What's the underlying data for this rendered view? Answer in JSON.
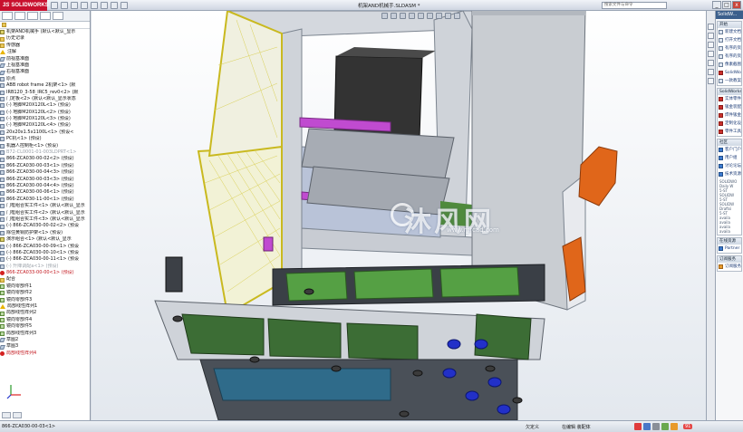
{
  "app": {
    "logo_prefix": "3S",
    "logo_text": "SOLIDWORKS",
    "document_title": "机架AND机械手.SLDASM *",
    "search_placeholder": "搜索文件与命令",
    "window_controls": [
      "_",
      "□",
      "x"
    ]
  },
  "tree": {
    "items": [
      {
        "label": "机架AND机械手  (默认<默认_显示",
        "icon": "asm-icon",
        "kind": "asm"
      },
      {
        "label": "历史记录",
        "icon": "history-icon",
        "kind": "folder"
      },
      {
        "label": "传感器",
        "icon": "sensor-icon",
        "kind": "folder"
      },
      {
        "label": "注解",
        "icon": "warning-icon",
        "kind": "warn"
      },
      {
        "label": "前视基准面",
        "icon": "plane-icon",
        "kind": "plane"
      },
      {
        "label": "上视基准面",
        "icon": "plane-icon",
        "kind": "plane"
      },
      {
        "label": "右视基准面",
        "icon": "plane-icon",
        "kind": "plane"
      },
      {
        "label": "原点",
        "icon": "origin-icon",
        "kind": "part"
      },
      {
        "label": "ABB robot frame 2机架<1> (默",
        "icon": "part-icon",
        "kind": "part"
      },
      {
        "label": "IRB120_3-58_IRC5_rev0<2> (默",
        "icon": "part-icon",
        "kind": "part"
      },
      {
        "label": "门定板<2> (默认<默认_显示状态",
        "icon": "part-icon",
        "kind": "part"
      },
      {
        "label": "(-) 地脚M20X120L<1> (预设)",
        "icon": "part-icon",
        "kind": "part"
      },
      {
        "label": "(-) 地脚M20X120L<2> (预设)",
        "icon": "part-icon",
        "kind": "part"
      },
      {
        "label": "(-) 地脚M20X120L<3> (预设)",
        "icon": "part-icon",
        "kind": "part"
      },
      {
        "label": "(-) 地脚M20X120L<4> (预设)",
        "icon": "part-icon",
        "kind": "part"
      },
      {
        "label": "20x20x1.5x1100L<1> (预设<",
        "icon": "part-icon",
        "kind": "part"
      },
      {
        "label": "PC机<1> (预设)",
        "icon": "part-icon",
        "kind": "part"
      },
      {
        "label": "机器人控制柜<1> (预设)",
        "icon": "part-icon",
        "kind": "part"
      },
      {
        "label": "B72-CL0001-01-003LDPRT<1>",
        "icon": "part-icon",
        "kind": "part",
        "grey": true
      },
      {
        "label": "866-ZCA030-00-02<2> (预设)",
        "icon": "part-icon",
        "kind": "part"
      },
      {
        "label": "866-ZCA030-00-03<1> (预设)",
        "icon": "part-icon",
        "kind": "part"
      },
      {
        "label": "866-ZCA030-00-04<3> (预设)",
        "icon": "part-icon",
        "kind": "part"
      },
      {
        "label": "866-ZCA030-00-03<3> (预设)",
        "icon": "part-icon",
        "kind": "part"
      },
      {
        "label": "866-ZCA030-00-04<4> (预设)",
        "icon": "part-icon",
        "kind": "part"
      },
      {
        "label": "866-ZCA030-00-06<1> (预设)",
        "icon": "part-icon",
        "kind": "part"
      },
      {
        "label": "866-ZCA030-11-00<1> (预设)",
        "icon": "part-icon",
        "kind": "part"
      },
      {
        "label": "门框组合实工件<1> (默认<默认_显示",
        "icon": "part-icon",
        "kind": "part"
      },
      {
        "label": "门框组合实工件<2> (默认<默认_显示",
        "icon": "part-icon",
        "kind": "part"
      },
      {
        "label": "门框组合实工件<3> (默认<默认_显示",
        "icon": "part-icon",
        "kind": "part"
      },
      {
        "label": "(-) 866-ZCA030-00-02<2> (预设",
        "icon": "part-icon",
        "kind": "part"
      },
      {
        "label": "除住黄铜防护架<1> (预设)",
        "icon": "part-icon",
        "kind": "part"
      },
      {
        "label": "演示组合<1> (默认<默认_显示",
        "icon": "asm-icon",
        "kind": "asm"
      },
      {
        "label": "(-) 866-ZCA030-00-09<1> (预设",
        "icon": "part-icon",
        "kind": "part"
      },
      {
        "label": "(-) 866-ZCA030-00-10<1> (预设",
        "icon": "part-icon",
        "kind": "part"
      },
      {
        "label": "(-) 866-ZCA030-00-11<1> (预设",
        "icon": "part-icon",
        "kind": "part"
      },
      {
        "label": "(-) 升降调配a<1> (预设)",
        "icon": "part-icon",
        "kind": "part",
        "grey": true
      },
      {
        "label": "866-ZCA033-00-00<1> (预设)",
        "icon": "error-icon",
        "kind": "err",
        "red": true
      },
      {
        "label": "配合",
        "icon": "mates-icon",
        "kind": "folder"
      },
      {
        "label": "镜向零部件1",
        "icon": "mirror-icon",
        "kind": "pattern"
      },
      {
        "label": "镜向零部件2",
        "icon": "mirror-icon",
        "kind": "pattern"
      },
      {
        "label": "镜向零部件3",
        "icon": "mirror-icon",
        "kind": "pattern"
      },
      {
        "label": "局部线性阵列1",
        "icon": "warning-icon",
        "kind": "warn"
      },
      {
        "label": "局部线性阵列2",
        "icon": "pattern-icon",
        "kind": "pattern"
      },
      {
        "label": "镜向零部件4",
        "icon": "mirror-icon",
        "kind": "pattern"
      },
      {
        "label": "镜向零部件5",
        "icon": "mirror-icon",
        "kind": "pattern"
      },
      {
        "label": "局部线性阵列3",
        "icon": "pattern-icon",
        "kind": "pattern"
      },
      {
        "label": "草图2",
        "icon": "sketch-icon",
        "kind": "plane"
      },
      {
        "label": "草图3",
        "icon": "sketch-icon",
        "kind": "plane"
      },
      {
        "label": "局部线性阵列4",
        "icon": "error-icon",
        "kind": "err",
        "red": true
      }
    ]
  },
  "viewport": {
    "watermark_text": "沐风网",
    "watermark_url": "www.mfcad.com"
  },
  "task_pane": {
    "header": "SolidW...",
    "sections": [
      {
        "title": "开始",
        "items": [
          {
            "label": "新建文档",
            "icon": "new-document-icon",
            "color": ""
          },
          {
            "label": "打开文档",
            "icon": "open-document-icon",
            "color": ""
          },
          {
            "label": "有序的资源",
            "icon": "resource-icon",
            "color": ""
          },
          {
            "label": "有序的资源",
            "icon": "resource-icon",
            "color": ""
          },
          {
            "label": "像素截图",
            "icon": "screenshot-icon",
            "color": ""
          },
          {
            "label": "SolidWo",
            "icon": "solidworks-icon",
            "color": "red"
          },
          {
            "label": "一款教案",
            "icon": "tutorial-icon",
            "color": ""
          }
        ]
      },
      {
        "title": "SolidWorks",
        "items": [
          {
            "label": "实体零件",
            "icon": "solid-part-icon",
            "color": "red"
          },
          {
            "label": "钣金装配",
            "icon": "sheetmetal-icon",
            "color": "red"
          },
          {
            "label": "焊件钣金",
            "icon": "weldment-icon",
            "color": "red"
          },
          {
            "label": "定制化设计",
            "icon": "custom-design-icon",
            "color": "red"
          },
          {
            "label": "零件工具",
            "icon": "part-tools-icon",
            "color": "red"
          }
        ]
      },
      {
        "title": "社区",
        "items": [
          {
            "label": "客户门户",
            "icon": "portal-icon",
            "color": "blue"
          },
          {
            "label": "用户组",
            "icon": "user-group-icon",
            "color": "blue"
          },
          {
            "label": "讨论论坛",
            "icon": "forum-icon",
            "color": "blue"
          },
          {
            "label": "技术资源",
            "icon": "tech-resource-icon",
            "color": "blue"
          }
        ],
        "lines": [
          "SOLIDWO",
          "Daily W",
          "5-ST",
          "SOLIDW",
          "5-ST",
          "SOLIDW",
          "Draftsi",
          "5-ST",
          "availa",
          "availa",
          "availa",
          "availa"
        ]
      },
      {
        "title": "在线资源",
        "items": [
          {
            "label": "Partner S",
            "icon": "partner-icon",
            "color": "blue"
          }
        ]
      },
      {
        "title": "订阅服务",
        "items": [
          {
            "label": "订阅服务",
            "icon": "subscription-icon",
            "color": "orange"
          }
        ]
      }
    ]
  },
  "status": {
    "text": "866-ZCA030-00-03<1>",
    "defined": "欠定义",
    "editing": "在编辑 装配体",
    "badge": "91"
  },
  "colors": {
    "accent": "#c8102e",
    "frame_grey": "#cfd3d9",
    "mesh_yellow": "#e6d24a",
    "pcb_green": "#4f8a3c",
    "robot_orange": "#e0661a",
    "magenta": "#c04bd0"
  }
}
